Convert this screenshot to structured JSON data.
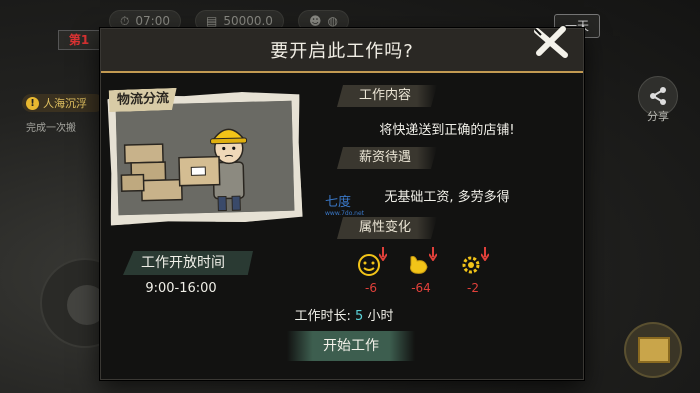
{
  "hud": {
    "day_badge": "第1",
    "time": "07:00",
    "money": "50000.0",
    "day_button": "一天",
    "task_title": "人海沉浮",
    "task_sub": "完成一次搬",
    "share_label": "分享"
  },
  "modal": {
    "title": "要开启此工作吗?",
    "illustration_tag": "物流分流",
    "content_label": "工作内容",
    "content_text": "将快递送到正确的店铺!",
    "salary_label": "薪资待遇",
    "salary_text": "无基础工资, 多劳多得",
    "attr_label": "属性变化",
    "attributes": [
      {
        "icon": "mood-smiley-icon",
        "delta": "-6"
      },
      {
        "icon": "stomach-icon",
        "delta": "-64"
      },
      {
        "icon": "energy-gear-icon",
        "delta": "-2"
      }
    ],
    "open_time_label": "工作开放时间",
    "open_time_value": "9:00-16:00",
    "duration_prefix": "工作时长:",
    "duration_value": "5",
    "duration_unit": "小时",
    "start_button": "开始工作"
  },
  "watermark": {
    "text": "七度",
    "url": "www.7do.net"
  },
  "colors": {
    "accent_gold": "#c29a52",
    "delta_red": "#e0403a",
    "duration_cyan": "#5ad2d8",
    "button_green": "#3d5e4f"
  }
}
